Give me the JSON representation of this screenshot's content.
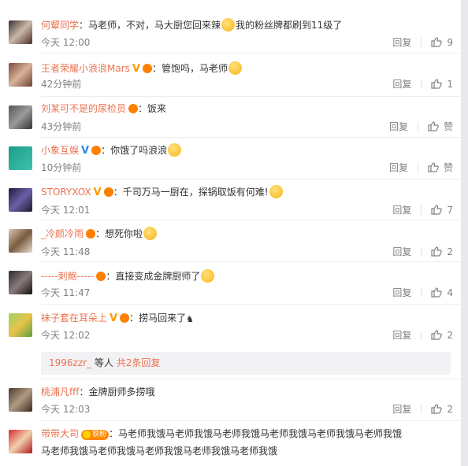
{
  "comments": [
    {
      "user": "何颦同学",
      "text": "：马老师，不对，马大厨您回来辣",
      "text2": "我的粉丝牌都刷到11级了",
      "time": "今天 12:00",
      "reply": "回复",
      "likes": "9"
    },
    {
      "user": "王者荣耀小浪浪Mars",
      "text": "：管饱吗，马老师",
      "time": "42分钟前",
      "reply": "回复",
      "likes": "1"
    },
    {
      "user": "刘某可不是的尿检员",
      "text": "：饭来",
      "time": "43分钟前",
      "reply": "回复",
      "likes": "赞"
    },
    {
      "user": "小象互娱",
      "text": "：你饿了吗浪浪",
      "time": "10分钟前",
      "reply": "回复",
      "likes": "赞"
    },
    {
      "user": "STORYXOX",
      "text": "：千司万马一厨在，探锅取饭有何难!",
      "time": "今天 12:01",
      "reply": "回复",
      "likes": "7"
    },
    {
      "user": "_冷颜冷雨",
      "text": "：想死你啦",
      "time": "今天 11:48",
      "reply": "回复",
      "likes": "2"
    },
    {
      "user": "-----刺鲍-----",
      "text": "：直接变成金牌厨师了",
      "time": "今天 11:47",
      "reply": "回复",
      "likes": "4"
    },
    {
      "user": "袜子套在耳朵上",
      "text": "：捞马回来了",
      "time": "今天 12:02",
      "reply": "回复",
      "likes": "2"
    },
    {
      "user": "桃浦凡fff",
      "text": "：金牌厨师多捞哦",
      "time": "今天 12:03",
      "reply": "回复",
      "likes": "2"
    },
    {
      "user": "带带大司",
      "text": "：马老师我饿马老师我饿马老师我饿马老师我饿马老师我饿马老师我饿",
      "text2": "马老师我饿马老师我饿马老师我饿马老师我饿马老师我饿",
      "fans_badge": "铁粉"
    }
  ],
  "subreplies": {
    "who": "1996zzr_",
    "mid": " 等人 ",
    "more": "共2条回复"
  },
  "colors": {
    "username": "#eb7350",
    "meta": "#808080",
    "vip_orange": "#ff9900",
    "verified_blue": "#2b8ae8"
  }
}
